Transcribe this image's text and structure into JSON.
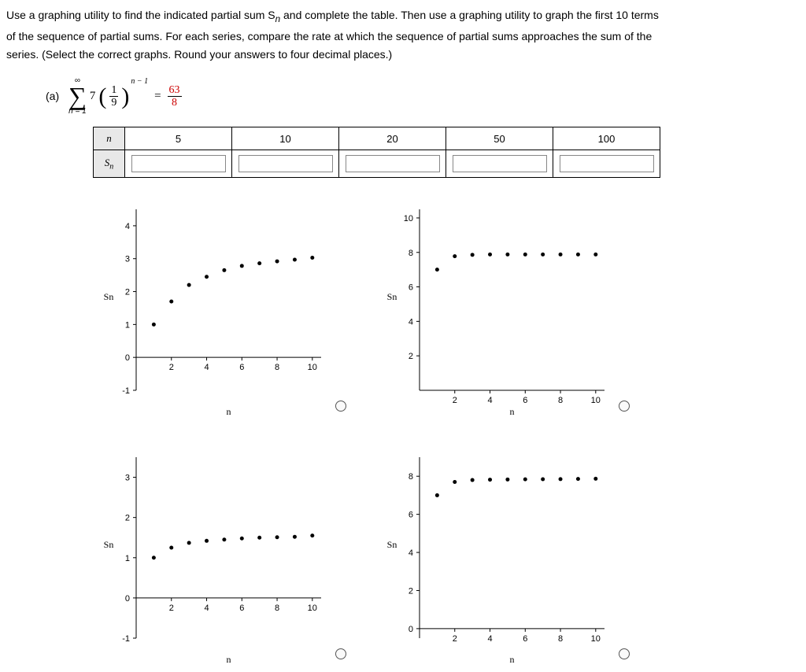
{
  "question": {
    "line1": "Use a graphing utility to find the indicated partial sum S",
    "line1_sub": "n",
    "line1_end": " and complete the table. Then use a graphing utility to graph the first 10 terms",
    "line2": "of the sequence of partial sums. For each series, compare the rate at which the sequence of partial sums approaches the sum of the",
    "line3": "series. (Select the correct graphs. Round your answers to four decimal places.)"
  },
  "part_a": {
    "label": "(a)",
    "sigma_top": "∞",
    "sigma_bottom": "n = 1",
    "coeff": "7",
    "frac_num": "1",
    "frac_den": "9",
    "exp": "n − 1",
    "eq": "=",
    "res_num": "63",
    "res_den": "8"
  },
  "table": {
    "header_n": "n",
    "header_sn": "S",
    "header_sn_sub": "n",
    "cols": [
      "5",
      "10",
      "20",
      "50",
      "100"
    ]
  },
  "charts": {
    "ylabel": "Sn",
    "xlabel": "n"
  },
  "chart_data": [
    {
      "type": "scatter",
      "xlabel": "n",
      "ylabel": "Sn",
      "x": [
        1,
        2,
        3,
        4,
        5,
        6,
        7,
        8,
        9,
        10
      ],
      "y": [
        1.0,
        1.7,
        2.2,
        2.45,
        2.65,
        2.78,
        2.86,
        2.92,
        2.97,
        3.03
      ],
      "xticks": [
        2,
        4,
        6,
        8,
        10
      ],
      "yticks": [
        -1,
        0,
        1,
        2,
        3,
        4
      ],
      "ylim": [
        -1,
        4.5
      ]
    },
    {
      "type": "scatter",
      "xlabel": "n",
      "ylabel": "Sn",
      "x": [
        1,
        2,
        3,
        4,
        5,
        6,
        7,
        8,
        9,
        10
      ],
      "y": [
        7.0,
        7.78,
        7.86,
        7.88,
        7.88,
        7.88,
        7.88,
        7.88,
        7.88,
        7.88
      ],
      "xticks": [
        2,
        4,
        6,
        8,
        10
      ],
      "yticks": [
        2,
        4,
        6,
        8,
        10
      ],
      "ylim": [
        0,
        10.5
      ]
    },
    {
      "type": "scatter",
      "xlabel": "n",
      "ylabel": "Sn",
      "x": [
        1,
        2,
        3,
        4,
        5,
        6,
        7,
        8,
        9,
        10
      ],
      "y": [
        1.0,
        1.25,
        1.37,
        1.42,
        1.45,
        1.48,
        1.5,
        1.51,
        1.52,
        1.55
      ],
      "xticks": [
        2,
        4,
        6,
        8,
        10
      ],
      "yticks": [
        -1,
        0,
        1,
        2,
        3
      ],
      "ylim": [
        -1,
        3.5
      ]
    },
    {
      "type": "scatter",
      "xlabel": "n",
      "ylabel": "Sn",
      "x": [
        1,
        2,
        3,
        4,
        5,
        6,
        7,
        8,
        9,
        10
      ],
      "y": [
        7.0,
        7.7,
        7.8,
        7.82,
        7.83,
        7.84,
        7.845,
        7.85,
        7.86,
        7.87
      ],
      "xticks": [
        2,
        4,
        6,
        8,
        10
      ],
      "yticks": [
        0,
        2,
        4,
        6,
        8
      ],
      "ylim": [
        -0.5,
        9
      ]
    }
  ]
}
